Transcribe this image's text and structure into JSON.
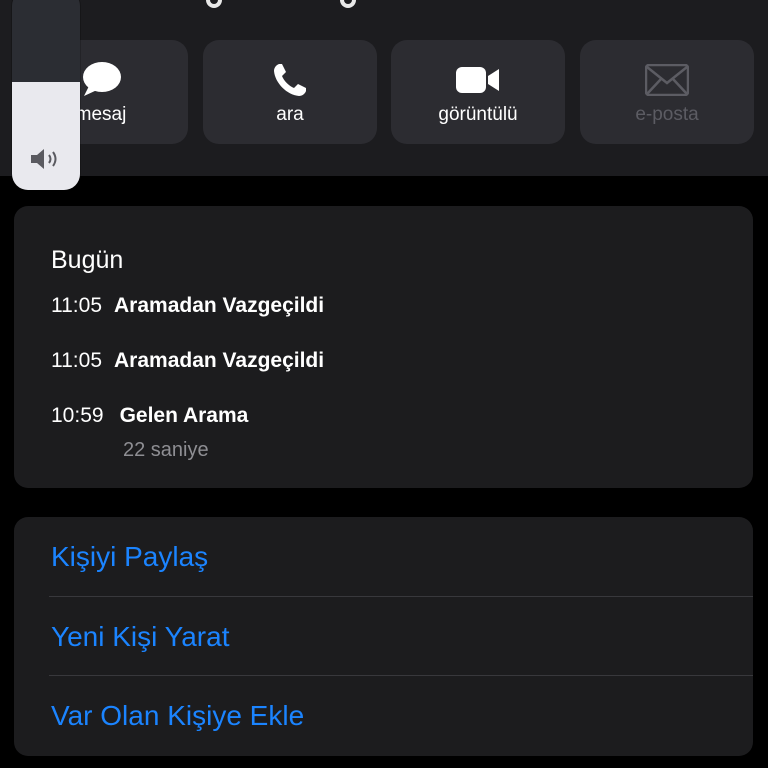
{
  "actions": {
    "message_label": "mesaj",
    "call_label": "ara",
    "video_label": "görüntülü",
    "email_label": "e-posta"
  },
  "volume": {
    "level_fraction": 0.54,
    "icon": "speaker-icon"
  },
  "history": {
    "title": "Bugün",
    "entries": [
      {
        "time": "11:05",
        "type": "Aramadan Vazgeçildi"
      },
      {
        "time": "11:05",
        "type": "Aramadan Vazgeçildi"
      },
      {
        "time": "10:59",
        "type": "Gelen Arama",
        "duration": "22 saniye"
      }
    ]
  },
  "contact_actions": {
    "share": "Kişiyi Paylaş",
    "create_new": "Yeni Kişi Yarat",
    "add_existing": "Var Olan Kişiye Ekle"
  },
  "colors": {
    "background": "#000000",
    "card": "#1c1c1e",
    "button": "#2c2c31",
    "link": "#1b84ff",
    "secondary_text": "#8e8e93",
    "disabled_text": "#5c5c63"
  }
}
